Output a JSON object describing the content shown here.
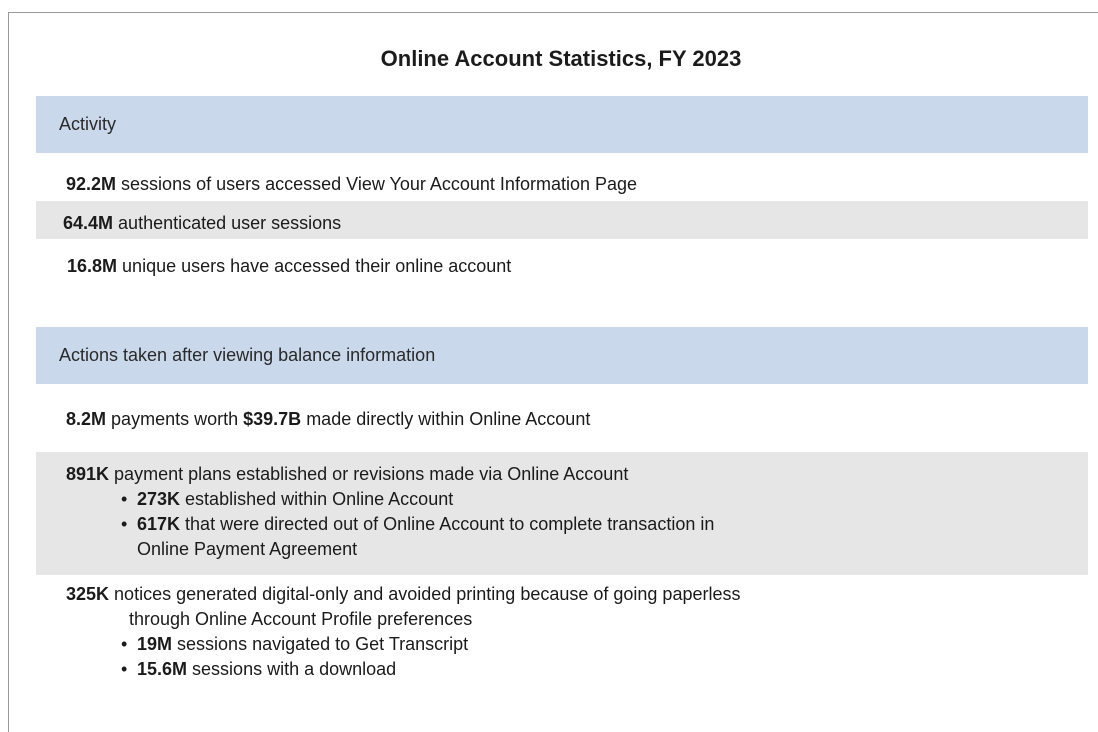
{
  "title": "Online Account Statistics, FY 2023",
  "activity": {
    "header": "Activity",
    "items": [
      {
        "value": "92.2M",
        "text": "sessions of users accessed View Your Account Information Page"
      },
      {
        "value": "64.4M",
        "text": "authenticated user sessions"
      },
      {
        "value": "16.8M",
        "text": "unique users have accessed their online account"
      }
    ]
  },
  "actions": {
    "header": "Actions taken after viewing balance information",
    "payments": {
      "value": "8.2M",
      "text_a": "payments worth",
      "amount": "$39.7B",
      "text_b": "made directly within Online Account"
    },
    "plans": {
      "value": "891K",
      "text": "payment plans established or revisions made via Online Account",
      "subs": [
        {
          "value": "273K",
          "text": "established within Online Account"
        },
        {
          "value": "617K",
          "text": "that were directed out of Online Account to complete transaction in",
          "text_cont": "Online Payment Agreement"
        }
      ]
    },
    "notices": {
      "value": "325K",
      "text": "notices generated digital-only and avoided printing because of going paperless",
      "text_cont": "through Online Account Profile preferences",
      "subs": [
        {
          "value": "19M",
          "text": "sessions navigated to Get Transcript"
        },
        {
          "value": "15.6M",
          "text": "sessions with a download"
        }
      ]
    }
  }
}
